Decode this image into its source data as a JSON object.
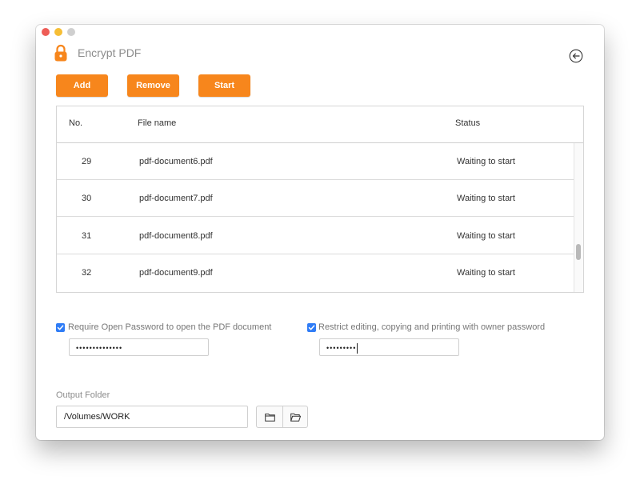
{
  "window": {
    "title": "Encrypt PDF"
  },
  "toolbar": {
    "add_label": "Add",
    "remove_label": "Remove",
    "start_label": "Start"
  },
  "table": {
    "headers": {
      "no": "No.",
      "file": "File name",
      "status": "Status"
    },
    "rows": [
      {
        "no": "29",
        "file": "pdf-document6.pdf",
        "status": "Waiting to start"
      },
      {
        "no": "30",
        "file": "pdf-document7.pdf",
        "status": "Waiting to start"
      },
      {
        "no": "31",
        "file": "pdf-document8.pdf",
        "status": "Waiting to start"
      },
      {
        "no": "32",
        "file": "pdf-document9.pdf",
        "status": "Waiting to start"
      }
    ]
  },
  "open_password": {
    "checked": true,
    "label": "Require Open Password to open the PDF document",
    "value": "••••••••••••••"
  },
  "owner_password": {
    "checked": true,
    "label": "Restrict editing, copying and printing with owner password",
    "value": "•••••••••"
  },
  "output": {
    "label": "Output Folder",
    "value": "/Volumes/WORK"
  },
  "icons": {
    "lock": "lock-icon",
    "back": "back-arrow-icon",
    "folder": "folder-icon",
    "folder_open": "open-folder-icon"
  },
  "colors": {
    "accent": "#f7861c",
    "checkbox": "#2f7cf6"
  }
}
